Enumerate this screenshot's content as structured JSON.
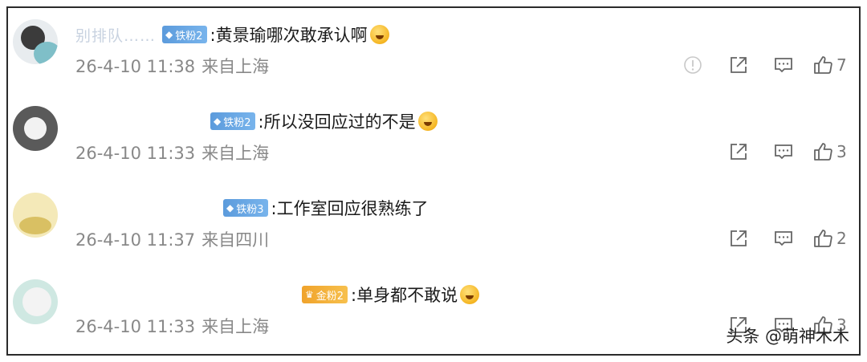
{
  "comments": [
    {
      "username": "别排队……",
      "badge_label": "铁粉2",
      "badge_type": "iron",
      "text": ":黄景瑜哪次敢承认啊",
      "emoji": "upside-down-face-emoji",
      "date": "26-4-10 11:38",
      "location": "来自上海",
      "likes": "7",
      "show_report": true
    },
    {
      "username": "",
      "badge_label": "铁粉2",
      "badge_type": "iron",
      "text": ":所以没回应过的不是",
      "emoji": "laughing-tears-emoji",
      "date": "26-4-10 11:33",
      "location": "来自上海",
      "likes": "3",
      "show_report": false
    },
    {
      "username": "",
      "badge_label": "铁粉3",
      "badge_type": "iron",
      "text": ":工作室回应很熟练了",
      "emoji": "",
      "date": "26-4-10 11:37",
      "location": "来自四川",
      "likes": "2",
      "show_report": false
    },
    {
      "username": "",
      "badge_label": "金粉2",
      "badge_type": "gold",
      "text": ":单身都不敢说",
      "emoji": "hushed-face-emoji",
      "date": "26-4-10 11:33",
      "location": "来自上海",
      "likes": "3",
      "show_report": false
    }
  ],
  "watermark": "头条 @萌神木木",
  "colors": {
    "iron_badge": "#5c9bdc",
    "gold_badge": "#f0a32b",
    "meta_text": "#888888"
  }
}
